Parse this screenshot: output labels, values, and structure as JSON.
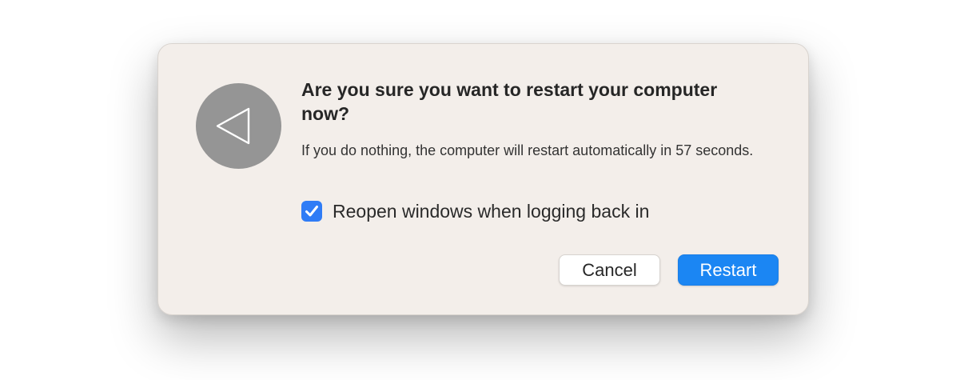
{
  "dialog": {
    "icon": "restart-back-arrow-icon",
    "title": "Are you sure you want to restart your computer now?",
    "message": "If you do nothing, the computer will restart automatically in 57 seconds.",
    "countdown_seconds": 57,
    "reopen_windows": {
      "label": "Reopen windows when logging back in",
      "checked": true,
      "icon": "checkmark-icon"
    },
    "buttons": {
      "cancel_label": "Cancel",
      "restart_label": "Restart"
    }
  },
  "colors": {
    "dialog_background": "#f3eeea",
    "icon_background": "#959595",
    "accent_blue": "#1b86f3",
    "checkbox_blue": "#2f7cf6"
  }
}
